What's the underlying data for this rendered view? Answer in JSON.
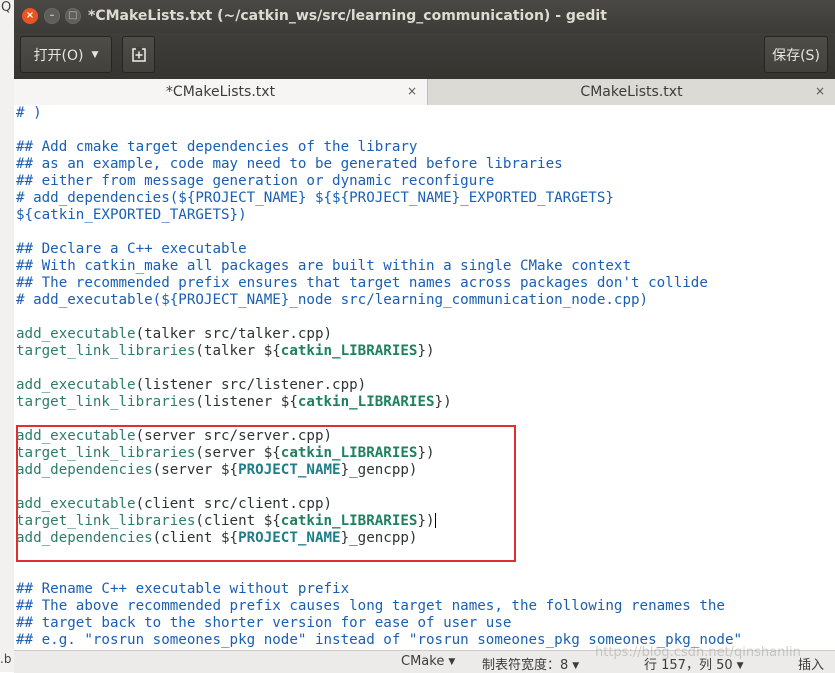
{
  "window": {
    "title": "*CMakeLists.txt (~/catkin_ws/src/learning_communication) - gedit",
    "close_glyph": "×",
    "min_glyph": "–",
    "max_glyph": "□"
  },
  "left_strip": {
    "top_glyph": "Q",
    "bottom_glyph": ".b"
  },
  "header": {
    "open_label": "打开(O)",
    "open_arrow": "▼",
    "save_label": "保存(S)"
  },
  "tabs": [
    {
      "label": "*CMakeLists.txt",
      "close": "×"
    },
    {
      "label": "CMakeLists.txt",
      "close": "×"
    }
  ],
  "lines": [
    "# )",
    "",
    "## Add cmake target dependencies of the library",
    "## as an example, code may need to be generated before libraries",
    "## either from message generation or dynamic reconfigure",
    "# add_dependencies(${PROJECT_NAME} ${${PROJECT_NAME}_EXPORTED_TARGETS}",
    "${catkin_EXPORTED_TARGETS})",
    "",
    "## Declare a C++ executable",
    "## With catkin_make all packages are built within a single CMake context",
    "## The recommended prefix ensures that target names across packages don't collide",
    "# add_executable(${PROJECT_NAME}_node src/learning_communication_node.cpp)",
    "",
    "add_executable(talker src/talker.cpp)",
    "target_link_libraries(talker ${catkin_LIBRARIES})",
    "",
    "add_executable(listener src/listener.cpp)",
    "target_link_libraries(listener ${catkin_LIBRARIES})",
    "",
    "add_executable(server src/server.cpp)",
    "target_link_libraries(server ${catkin_LIBRARIES})",
    "add_dependencies(server ${PROJECT_NAME}_gencpp)",
    "",
    "add_executable(client src/client.cpp)",
    "target_link_libraries(client ${catkin_LIBRARIES})",
    "add_dependencies(client ${PROJECT_NAME}_gencpp)",
    "",
    "",
    "## Rename C++ executable without prefix",
    "## The above recommended prefix causes long target names, the following renames the",
    "## target back to the shorter version for ease of user use",
    "## e.g. \"rosrun someones_pkg node\" instead of \"rosrun someones_pkg someones_pkg_node\""
  ],
  "status": {
    "language": "CMake",
    "tab_width": "制表符宽度：8",
    "position": "行 157，列 50",
    "mode": "插入",
    "watermark": "https://blog.csdn.net/qinshanlin"
  },
  "colors": {
    "comment": "#1a5fb4",
    "function": "#2e7d6b",
    "variable": "#208060",
    "project_var": "#1f7d8a",
    "highlight": "#e0302e"
  }
}
